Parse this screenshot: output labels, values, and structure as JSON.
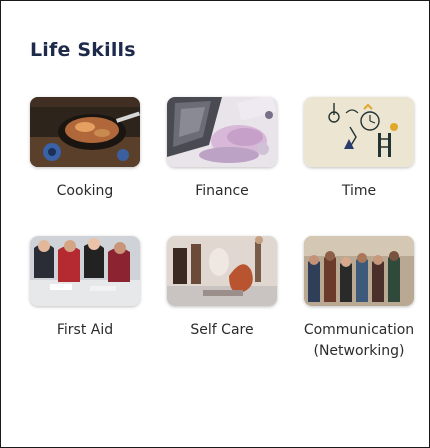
{
  "section": {
    "title": "Life Skills"
  },
  "skills": [
    {
      "label": "Cooking",
      "image": "cooking-photo"
    },
    {
      "label": "Finance",
      "image": "finance-photo"
    },
    {
      "label": "Time",
      "image": "time-illustration"
    },
    {
      "label": "First Aid",
      "image": "first-aid-photo"
    },
    {
      "label": "Self Care",
      "image": "self-care-photo"
    },
    {
      "label": "Communication",
      "label_line2": "(Networking)",
      "image": "communication-photo"
    }
  ]
}
